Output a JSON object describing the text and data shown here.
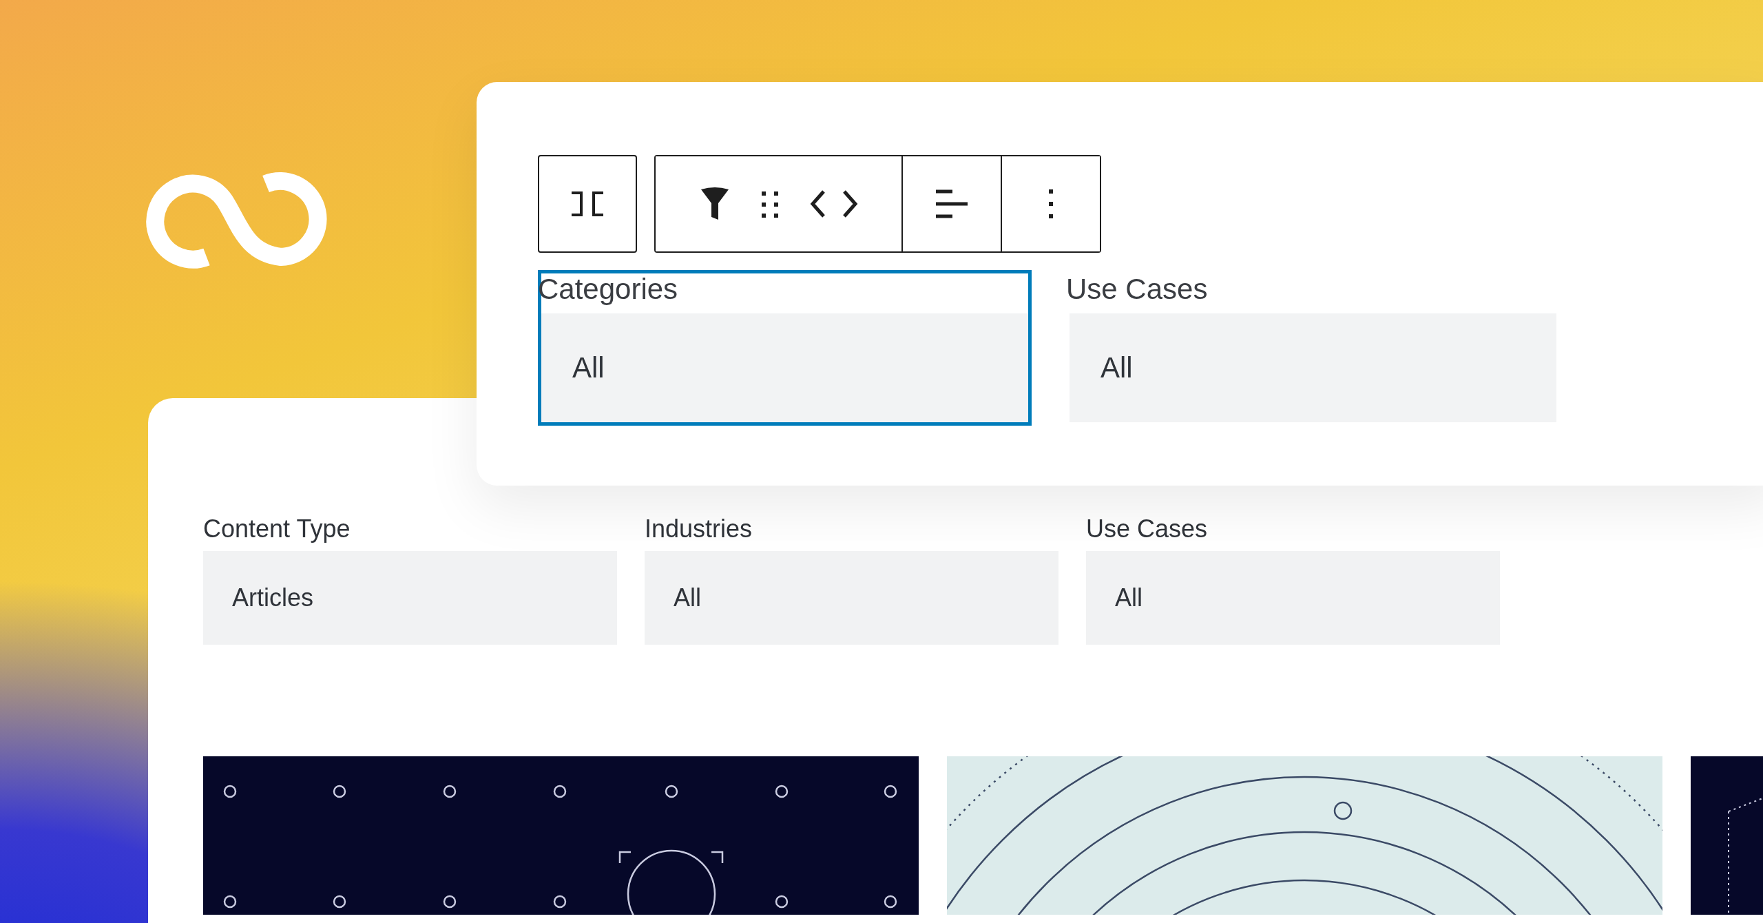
{
  "block_panel": {
    "fields": [
      {
        "label": "Categories",
        "value": "All",
        "selected": true
      },
      {
        "label": "Use Cases",
        "value": "All",
        "selected": false
      }
    ]
  },
  "filter_panel": {
    "fields": [
      {
        "label": "Content Type",
        "value": "Articles"
      },
      {
        "label": "Industries",
        "value": "All"
      },
      {
        "label": "Use Cases",
        "value": "All"
      }
    ]
  }
}
